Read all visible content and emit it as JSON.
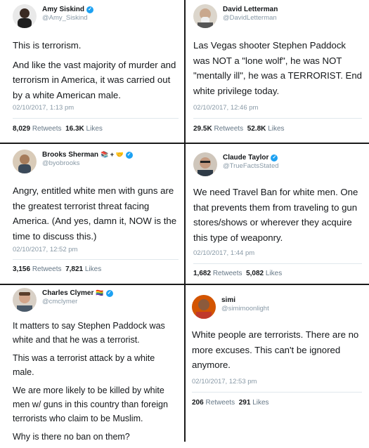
{
  "tweets": [
    {
      "name": "Amy Siskind",
      "handle": "@Amy_Siskind",
      "verified": true,
      "paragraphs": [
        "This is terrorism.",
        "And like the vast majority of murder and terrorism in America, it was carried out by a white American male."
      ],
      "timestamp": "02/10/2017, 1:13 pm",
      "retweets": "8,029",
      "likes": "16.3K",
      "avatar_color": "#2b2b2b"
    },
    {
      "name": "David Letterman",
      "handle": "@DavidLetterman",
      "verified": false,
      "paragraphs": [
        "Las Vegas shooter Stephen Paddock was NOT a \"lone wolf\", he was NOT \"mentally ill\", he was a TERRORIST. End white privilege today."
      ],
      "timestamp": "02/10/2017, 12:46 pm",
      "retweets": "29.5K",
      "likes": "52.8K",
      "avatar_color": "#b9b3a8"
    },
    {
      "name": "Brooks Sherman",
      "name_suffix": "📚 + 🤝",
      "handle": "@byobrooks",
      "verified": true,
      "paragraphs": [
        "Angry, entitled white men with guns are the greatest terrorist threat facing America. (And yes, damn it, NOW is the time to discuss this.)"
      ],
      "timestamp": "02/10/2017, 12:52 pm",
      "retweets": "3,156",
      "likes": "7,821",
      "avatar_color": "#6b5a4a"
    },
    {
      "name": "Claude Taylor",
      "handle": "@TrueFactsStated",
      "verified": true,
      "paragraphs": [
        "We need Travel Ban for white men. One that prevents them from traveling to gun stores/shows or wherever they acquire this type of weaponry."
      ],
      "timestamp": "02/10/2017, 1:44 pm",
      "retweets": "1,682",
      "likes": "5,082",
      "avatar_color": "#7a6e62"
    },
    {
      "name": "Charles Clymer",
      "name_suffix": "🏳️‍🌈",
      "handle": "@cmclymer",
      "verified": true,
      "paragraphs": [
        "It matters to say Stephen Paddock was white and that he was a terrorist.",
        "This was a terrorist attack by a white male.",
        "We are more likely to be killed by white men w/ guns in this country than foreign terrorists who claim to be Muslim.",
        "Why is there no ban on them?"
      ],
      "timestamp": "",
      "retweets": "",
      "likes": "",
      "avatar_color": "#8a6a55"
    },
    {
      "name": "simi",
      "handle": "@simimoonlight",
      "verified": false,
      "paragraphs": [
        "White people are terrorists. There are no more excuses. This can't be ignored anymore."
      ],
      "timestamp": "02/10/2017, 12:53 pm",
      "retweets": "206",
      "likes": "291",
      "avatar_color": "#c0392b"
    }
  ],
  "labels": {
    "retweets": "Retweets",
    "likes": "Likes",
    "verified_glyph": "✓"
  }
}
